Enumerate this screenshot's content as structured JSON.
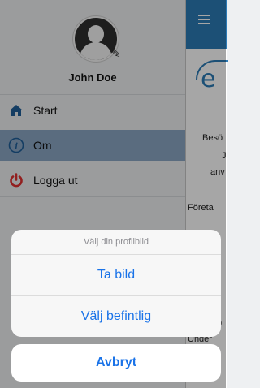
{
  "profile": {
    "name": "John Doe",
    "avatar_icon": "user-avatar-icon",
    "edit_icon": "pencil-icon"
  },
  "nav": [
    {
      "label": "Start",
      "icon": "home-icon",
      "active": false
    },
    {
      "label": "Om",
      "icon": "info-icon",
      "active": true
    },
    {
      "label": "Logga ut",
      "icon": "power-icon",
      "active": false
    }
  ],
  "main_peek": {
    "menu_icon": "hamburger-menu-icon",
    "logo_letter": "e",
    "fragments": [
      "Besö",
      "J",
      "anv",
      "Företa",
      "p",
      "Under",
      "ba"
    ]
  },
  "action_sheet": {
    "title": "Välj din profilbild",
    "options": [
      "Ta bild",
      "Välj befintlig"
    ],
    "cancel": "Avbryt"
  },
  "colors": {
    "accent": "#1a73e8",
    "topbar": "#2c7bb6",
    "active_item": "#8aa6c4",
    "logout_icon": "#e03030",
    "home_icon": "#1f5f99"
  }
}
